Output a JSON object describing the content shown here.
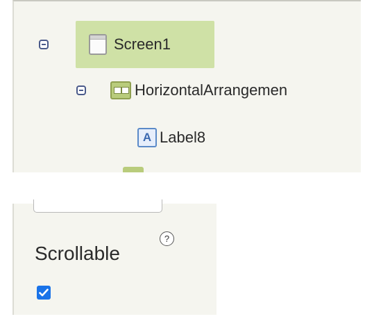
{
  "tree": {
    "nodes": [
      {
        "label": "Screen1",
        "icon": "screen-icon",
        "selected": true
      },
      {
        "label": "HorizontalArrangemen",
        "icon": "horizontal-arrangement-icon"
      },
      {
        "label": "Label8",
        "icon": "label-icon",
        "icon_glyph": "A"
      }
    ],
    "selected_color": "#cfe1a6"
  },
  "properties": {
    "scrollable_label": "Scrollable",
    "help_glyph": "?",
    "scrollable_checked": true,
    "checkbox_color": "#1a73e8"
  }
}
